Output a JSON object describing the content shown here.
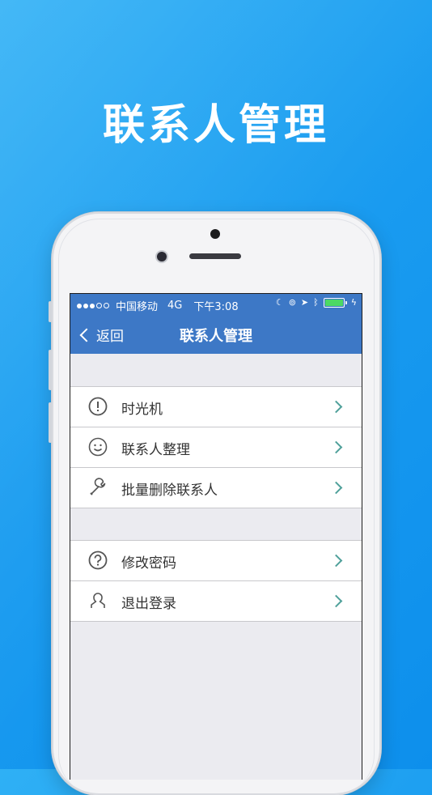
{
  "headline": "联系人管理",
  "status_bar": {
    "carrier": "中国移动",
    "network": "4G",
    "time": "下午3:08"
  },
  "nav": {
    "back_label": "返回",
    "title": "联系人管理"
  },
  "sections": [
    {
      "items": [
        {
          "label": "时光机",
          "icon": "exclamation-circle-icon"
        },
        {
          "label": "联系人整理",
          "icon": "smiley-icon"
        },
        {
          "label": "批量删除联系人",
          "icon": "wrench-icon"
        }
      ]
    },
    {
      "items": [
        {
          "label": "修改密码",
          "icon": "question-circle-icon"
        },
        {
          "label": "退出登录",
          "icon": "user-icon"
        }
      ]
    }
  ],
  "colors": {
    "background": "#1a9cf0",
    "navbar": "#3d78c6",
    "chevron": "#4fa09a",
    "battery": "#4cd964"
  }
}
